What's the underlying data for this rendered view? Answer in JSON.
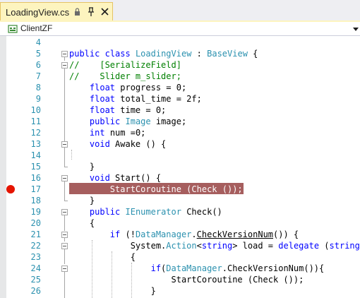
{
  "tab": {
    "title": "LoadingView.cs"
  },
  "nav": {
    "scope": "ClientZF"
  },
  "editor": {
    "breakpoint_line": "17",
    "lines": [
      {
        "n": "4",
        "t": ""
      },
      {
        "n": "5",
        "t": "public class LoadingView : BaseView {"
      },
      {
        "n": "6",
        "t": "//    [SerializeField]"
      },
      {
        "n": "7",
        "t": "//    Slider m_slider;"
      },
      {
        "n": "8",
        "t": "    float progress = 0;"
      },
      {
        "n": "9",
        "t": "    float total_time = 2f;"
      },
      {
        "n": "10",
        "t": "    float time = 0;"
      },
      {
        "n": "11",
        "t": "    public Image image;"
      },
      {
        "n": "12",
        "t": "    int num =0;"
      },
      {
        "n": "13",
        "t": "    void Awake () {"
      },
      {
        "n": "14",
        "t": ""
      },
      {
        "n": "15",
        "t": "    }"
      },
      {
        "n": "16",
        "t": "    void Start() {"
      },
      {
        "n": "17",
        "t": "        StartCoroutine (Check ());"
      },
      {
        "n": "18",
        "t": "    }"
      },
      {
        "n": "19",
        "t": "    public IEnumerator Check()"
      },
      {
        "n": "20",
        "t": "    {"
      },
      {
        "n": "21",
        "t": "        if (!DataManager.CheckVersionNum()) {"
      },
      {
        "n": "22",
        "t": "            System.Action<string> load = delegate (string t"
      },
      {
        "n": "23",
        "t": "            {"
      },
      {
        "n": "24",
        "t": "                if(DataManager.CheckVersionNum()){"
      },
      {
        "n": "25",
        "t": "                    StartCoroutine (Check ());"
      },
      {
        "n": "26",
        "t": "                }"
      }
    ]
  }
}
